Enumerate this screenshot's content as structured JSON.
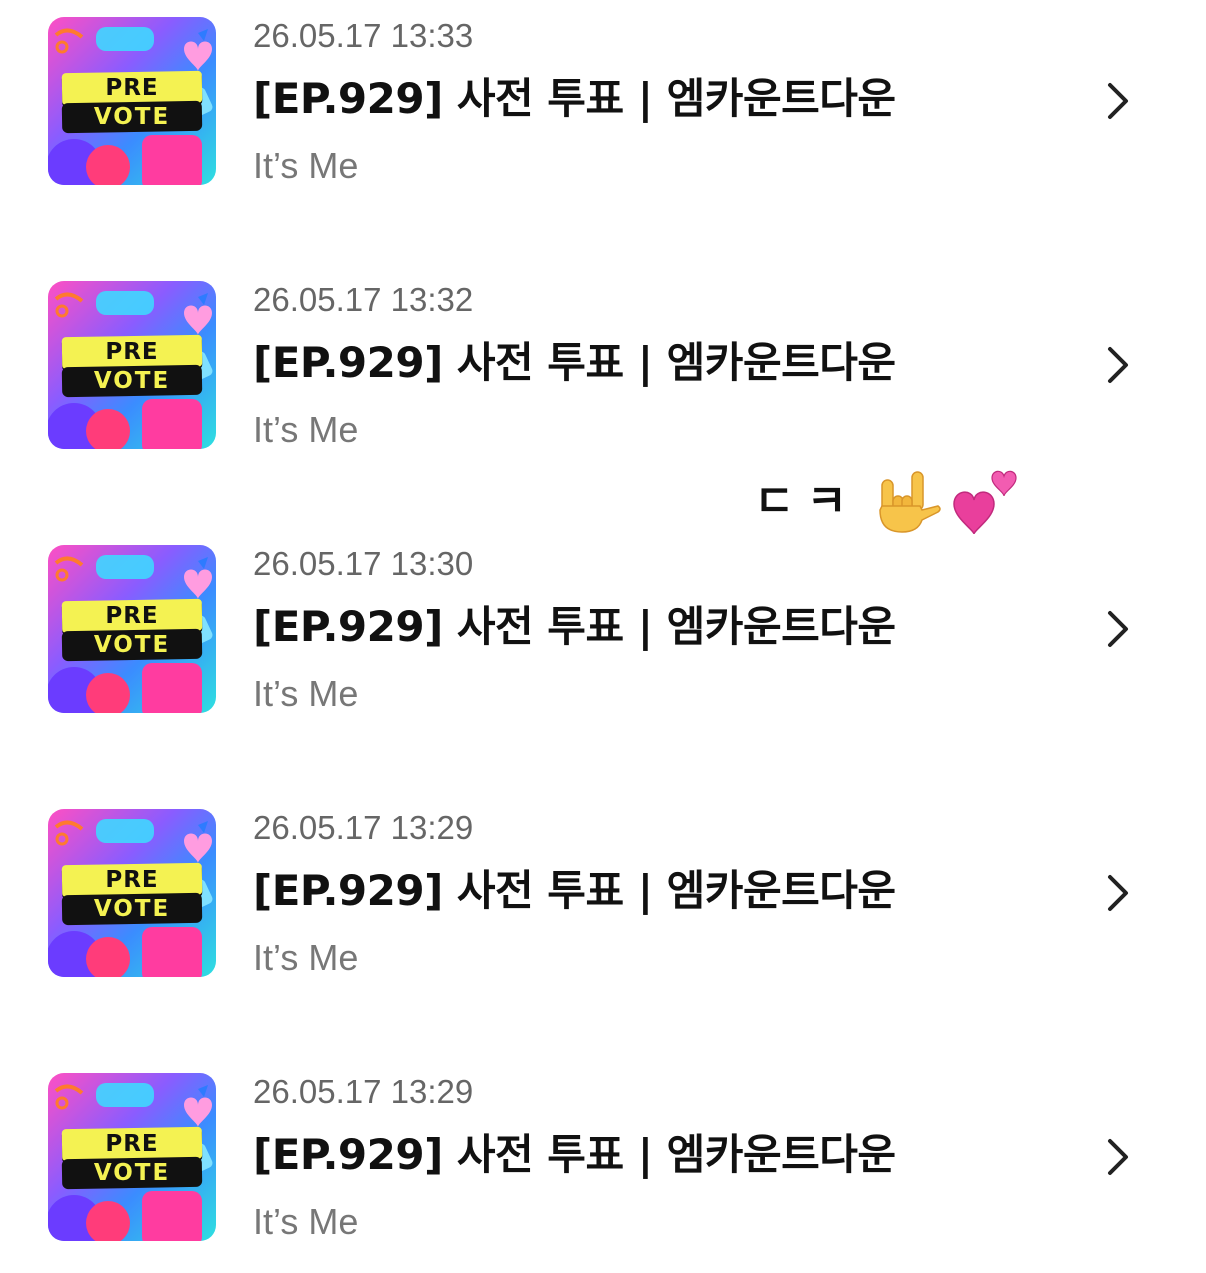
{
  "list": {
    "items": [
      {
        "timestamp": "26.05.17 13:33",
        "title": "[EP.929] 사전 투표 | 엠카운트다운",
        "subtitle": "It’s Me",
        "thumb": {
          "top": "PRE",
          "bottom": "VOTE"
        }
      },
      {
        "timestamp": "26.05.17 13:32",
        "title": "[EP.929] 사전 투표 | 엠카운트다운",
        "subtitle": "It’s Me",
        "thumb": {
          "top": "PRE",
          "bottom": "VOTE"
        }
      },
      {
        "timestamp": "26.05.17 13:30",
        "title": "[EP.929] 사전 투표 | 엠카운트다운",
        "subtitle": "It’s Me",
        "thumb": {
          "top": "PRE",
          "bottom": "VOTE"
        }
      },
      {
        "timestamp": "26.05.17 13:29",
        "title": "[EP.929] 사전 투표 | 엠카운트다운",
        "subtitle": "It’s Me",
        "thumb": {
          "top": "PRE",
          "bottom": "VOTE"
        }
      },
      {
        "timestamp": "26.05.17 13:29",
        "title": "[EP.929] 사전 투표 | 엠카운트다운",
        "subtitle": "It’s Me",
        "thumb": {
          "top": "PRE",
          "bottom": "VOTE"
        }
      }
    ]
  },
  "comment": {
    "text": "ㄷㅋ",
    "emoji": [
      "love-you-gesture-icon",
      "two-hearts-icon"
    ]
  },
  "colors": {
    "title": "#111111",
    "timestamp": "#666666",
    "subtitle": "#777777",
    "chevron": "#222222",
    "thumb_yellow": "#f4f252",
    "thumb_black": "#111111",
    "thumb_pink": "#ff4fc3",
    "thumb_blue": "#3b8cff",
    "thumb_cyan": "#2ee0e0"
  },
  "icons": {
    "row_chevron": "chevron-right-icon",
    "thumbnail": "pre-vote-thumbnail"
  }
}
